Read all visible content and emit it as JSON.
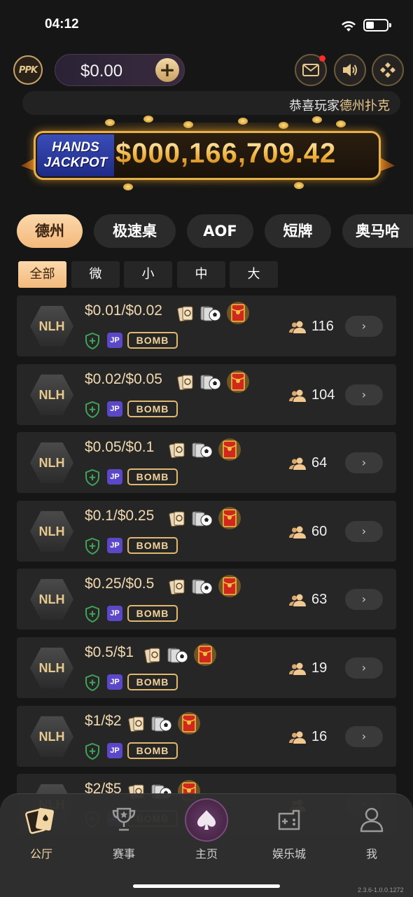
{
  "status_bar": {
    "time": "04:12"
  },
  "header": {
    "logo_text": "PPK",
    "balance": "$0.00",
    "buttons": [
      "mail",
      "sound",
      "settings"
    ]
  },
  "marquee": {
    "text_prefix": "恭喜玩家",
    "text_highlight": "德州扑克"
  },
  "jackpot": {
    "label_line1": "HANDS",
    "label_line2": "JACKPOT",
    "amount": "$000,166,709.42"
  },
  "game_tabs": [
    "德州",
    "极速桌",
    "AOF",
    "短牌",
    "奥马哈"
  ],
  "stake_filters": [
    "全部",
    "微",
    "小",
    "中",
    "大"
  ],
  "tables": [
    {
      "game": "NLH",
      "stakes": "$0.01/$0.02",
      "jp": "JP",
      "bomb": "BOMB",
      "players": "116"
    },
    {
      "game": "NLH",
      "stakes": "$0.02/$0.05",
      "jp": "JP",
      "bomb": "BOMB",
      "players": "104"
    },
    {
      "game": "NLH",
      "stakes": "$0.05/$0.1",
      "jp": "JP",
      "bomb": "BOMB",
      "players": "64"
    },
    {
      "game": "NLH",
      "stakes": "$0.1/$0.25",
      "jp": "JP",
      "bomb": "BOMB",
      "players": "60"
    },
    {
      "game": "NLH",
      "stakes": "$0.25/$0.5",
      "jp": "JP",
      "bomb": "BOMB",
      "players": "63"
    },
    {
      "game": "NLH",
      "stakes": "$0.5/$1",
      "jp": "JP",
      "bomb": "BOMB",
      "players": "19"
    },
    {
      "game": "NLH",
      "stakes": "$1/$2",
      "jp": "JP",
      "bomb": "BOMB",
      "players": "16"
    },
    {
      "game": "NLH",
      "stakes": "$2/$5",
      "jp": "JP",
      "bomb": "BOMB",
      "players": ""
    }
  ],
  "bottom_nav": [
    "公厅",
    "赛事",
    "主页",
    "娱乐城",
    "我"
  ],
  "version": "2.3.6-1.0.0.1272",
  "colors": {
    "accent": "#f3b97c",
    "gold": "#e6b04a",
    "bg": "#161616",
    "row": "#262626"
  }
}
